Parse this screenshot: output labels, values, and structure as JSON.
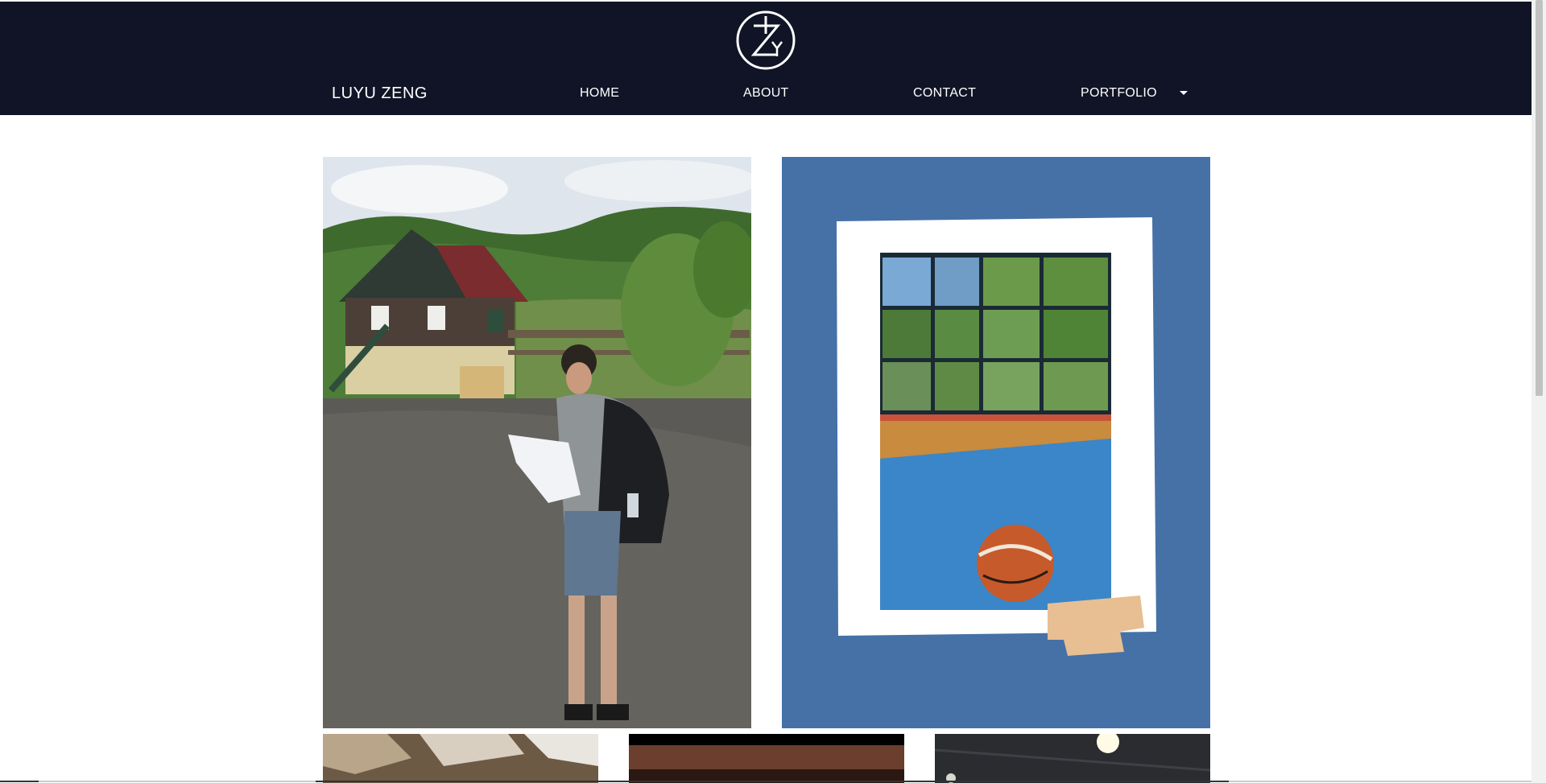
{
  "header": {
    "brand": "LUYU ZENG",
    "nav": {
      "home": "HOME",
      "about": "ABOUT",
      "contact": "CONTACT",
      "portfolio": "PORTFOLIO"
    },
    "background_color": "#111426"
  },
  "gallery": {
    "items": [
      {
        "subject": "person reading a map on a gravel road beside a wooden house"
      },
      {
        "subject": "basketball on an indoor court, framed print on blue background"
      },
      {
        "subject": "rock wall"
      },
      {
        "subject": "dark stage interior"
      },
      {
        "subject": "gym ceiling with lights"
      }
    ],
    "accent_color": "#4571a6"
  }
}
